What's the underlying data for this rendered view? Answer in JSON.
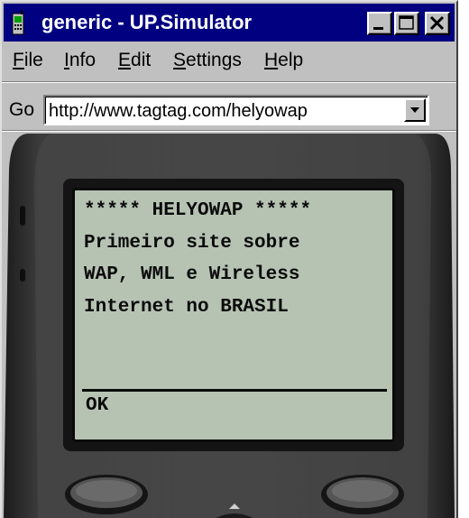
{
  "window": {
    "title": "generic - UP.Simulator",
    "buttons": {
      "minimize": "minimize",
      "maximize": "maximize",
      "close": "close"
    }
  },
  "menu": {
    "items": [
      {
        "accel": "F",
        "rest": "ile"
      },
      {
        "accel": "I",
        "rest": "nfo"
      },
      {
        "accel": "E",
        "rest": "dit"
      },
      {
        "accel": "S",
        "rest": "ettings"
      },
      {
        "accel": "H",
        "rest": "elp"
      }
    ]
  },
  "addressbar": {
    "go_label": "Go",
    "url": "http://www.tagtag.com/helyowap"
  },
  "phone": {
    "screen": {
      "lines": [
        "***** HELYOWAP *****",
        "Primeiro site sobre",
        "WAP, WML e Wireless",
        "Internet no BRASIL"
      ],
      "softkey_label": "OK"
    }
  },
  "colors": {
    "titlebar": "#000080",
    "chrome": "#c0c0c0",
    "lcd": "#b6c3b3",
    "phone_body": "#2b2b2b"
  },
  "icons": {
    "app": "phone-icon",
    "dropdown": "chevron-down-icon"
  }
}
